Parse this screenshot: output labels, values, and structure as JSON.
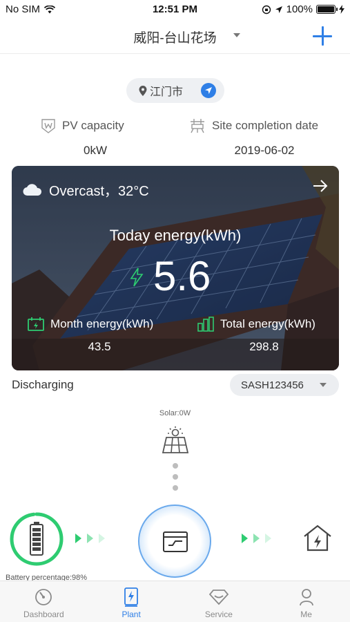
{
  "status_bar": {
    "carrier": "No SIM",
    "time": "12:51 PM",
    "battery": "100%"
  },
  "nav": {
    "title": "威阳-台山花场"
  },
  "location": {
    "city": "江门市"
  },
  "info": {
    "pv_capacity_label": "PV capacity",
    "pv_capacity_value": "0kW",
    "site_completion_label": "Site completion date",
    "site_completion_value": "2019-06-02"
  },
  "weather_card": {
    "weather_text": "Overcast，32°C",
    "today_energy_label": "Today energy(kWh)",
    "today_energy_value": "5.6",
    "month_energy_label": "Month energy(kWh)",
    "month_energy_value": "43.5",
    "total_energy_label": "Total energy(kWh)",
    "total_energy_value": "298.8"
  },
  "device": {
    "status": "Discharging",
    "selected": "SASH123456"
  },
  "flow": {
    "solar_label": "Solar:0W",
    "battery_label": "Battery percentage:98%",
    "battery_percent": 98,
    "accent": "#2ecc71",
    "inverter_color": "#2f7fe6"
  },
  "tabs": [
    {
      "label": "Dashboard",
      "icon": "gauge-icon",
      "active": false
    },
    {
      "label": "Plant",
      "icon": "plant-bolt-icon",
      "active": true
    },
    {
      "label": "Service",
      "icon": "service-diamond-icon",
      "active": false
    },
    {
      "label": "Me",
      "icon": "user-icon",
      "active": false
    }
  ],
  "colors": {
    "brand": "#2f7fe6",
    "tab_inactive": "#8a8a8a",
    "energy_green": "#2ecc71"
  }
}
